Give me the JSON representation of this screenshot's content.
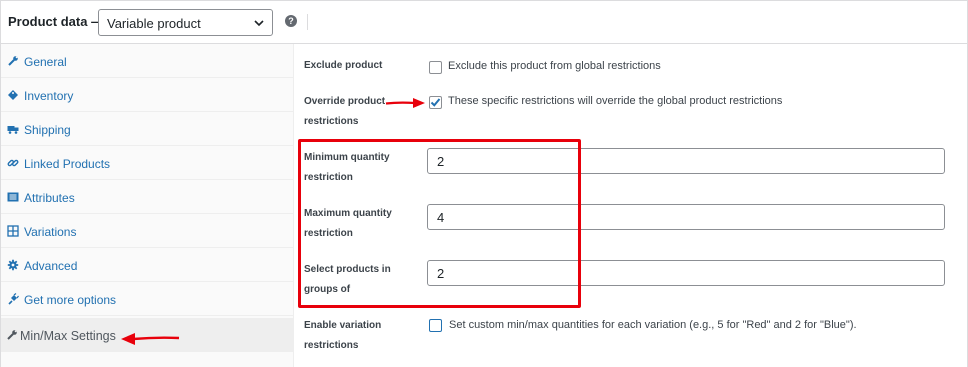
{
  "header": {
    "title": "Product data —",
    "product_type": "Variable product",
    "help_symbol": "?"
  },
  "sidebar": {
    "tabs": [
      {
        "label": "General",
        "icon": "wrench-icon"
      },
      {
        "label": "Inventory",
        "icon": "tag-icon"
      },
      {
        "label": "Shipping",
        "icon": "truck-icon"
      },
      {
        "label": "Linked Products",
        "icon": "link-icon"
      },
      {
        "label": "Attributes",
        "icon": "list-icon"
      },
      {
        "label": "Variations",
        "icon": "grid-icon"
      },
      {
        "label": "Advanced",
        "icon": "gear-icon"
      },
      {
        "label": "Get more options",
        "icon": "plugin-icon"
      },
      {
        "label": "Min/Max Settings",
        "icon": "wrench-icon",
        "active": true
      }
    ]
  },
  "fields": {
    "exclude": {
      "label": "Exclude product",
      "text": "Exclude this product from global restrictions",
      "checked": false
    },
    "override": {
      "label_line1": "Override product",
      "label_line2": "restrictions",
      "text": "These specific restrictions will override the global product restrictions",
      "checked": true
    },
    "min_qty": {
      "label_line1": "Minimum quantity",
      "label_line2": "restriction",
      "value": "2"
    },
    "max_qty": {
      "label_line1": "Maximum quantity",
      "label_line2": "restriction",
      "value": "4"
    },
    "group_of": {
      "label_line1": "Select products in",
      "label_line2": "groups of",
      "value": "2"
    },
    "variation": {
      "label_line1": "Enable variation",
      "label_line2": "restrictions",
      "text": "Set custom min/max quantities for each variation (e.g., 5 for \"Red\" and 2 for \"Blue\").",
      "checked": false
    }
  },
  "colors": {
    "link": "#2271b1",
    "annotation_red": "#e8000b",
    "checkbox_blue": "#2271b1"
  }
}
